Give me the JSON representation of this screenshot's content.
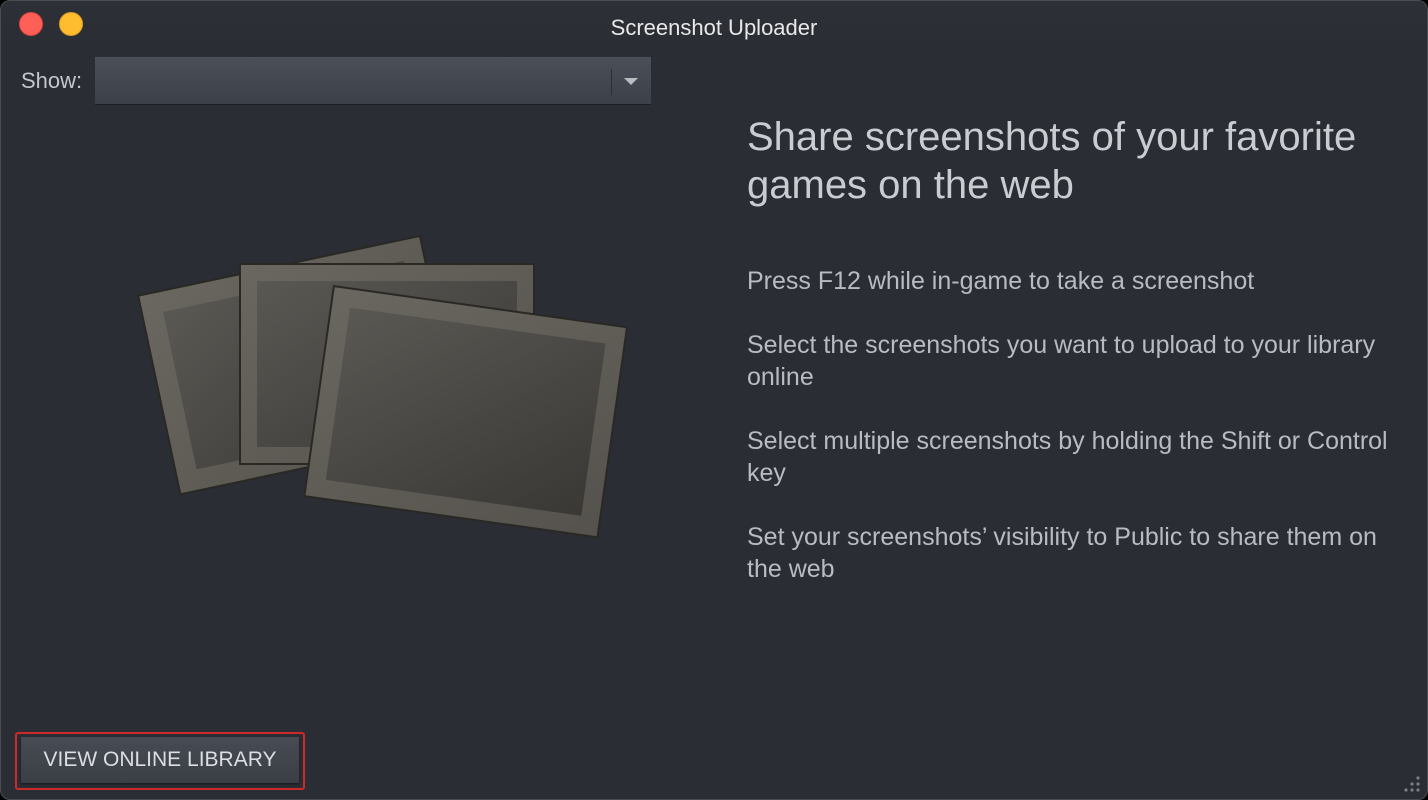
{
  "window": {
    "title": "Screenshot Uploader"
  },
  "filter": {
    "show_label": "Show:",
    "selected_value": ""
  },
  "content": {
    "headline": "Share screenshots of your favorite games on the web",
    "tips": [
      "Press F12 while in-game to take a screenshot",
      "Select the screenshots you want to upload to your library online",
      "Select multiple screenshots by holding the Shift or Control key",
      "Set your screenshots’ visibility to Public to share them on the web"
    ]
  },
  "footer": {
    "view_library_label": "VIEW ONLINE LIBRARY"
  },
  "icons": {
    "close": "close-window-icon",
    "minimize": "minimize-window-icon",
    "dropdown": "chevron-down-icon",
    "illustration": "screenshots-stack-icon",
    "resize": "resize-grip-icon"
  },
  "colors": {
    "background": "#2a2d33",
    "close": "#fe5f57",
    "minimize": "#febc2e",
    "highlight": "#cc2a2a"
  }
}
